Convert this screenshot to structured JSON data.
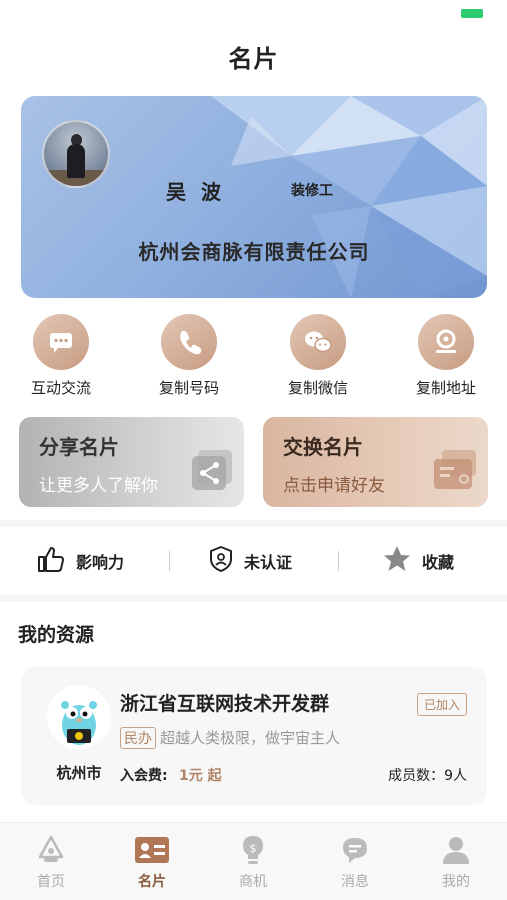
{
  "page": {
    "title": "名片"
  },
  "card": {
    "name": "吴  波",
    "job": "装修工",
    "company": "杭州会商脉有限责任公司"
  },
  "actions": [
    {
      "label": "互动交流",
      "icon": "chat-icon"
    },
    {
      "label": "复制号码",
      "icon": "phone-icon"
    },
    {
      "label": "复制微信",
      "icon": "wechat-icon"
    },
    {
      "label": "复制地址",
      "icon": "location-icon"
    }
  ],
  "promos": {
    "share": {
      "title": "分享名片",
      "subtitle": "让更多人了解你"
    },
    "exchange": {
      "title": "交换名片",
      "subtitle": "点击申请好友"
    }
  },
  "stats": {
    "influence": "影响力",
    "verify": "未认证",
    "favorite": "收藏"
  },
  "resources": {
    "section_title": "我的资源",
    "item": {
      "name": "浙江省互联网技术开发群",
      "joined": "已加入",
      "tag": "民办",
      "desc": "超越人类极限，做宇宙主人",
      "city": "杭州市",
      "fee_label": "入会费:",
      "fee": "1元 起",
      "members": "成员数：9人"
    }
  },
  "tabs": [
    {
      "label": "首页",
      "icon": "home-icon"
    },
    {
      "label": "名片",
      "icon": "card-icon",
      "active": true
    },
    {
      "label": "商机",
      "icon": "bulb-icon"
    },
    {
      "label": "消息",
      "icon": "message-icon"
    },
    {
      "label": "我的",
      "icon": "user-icon"
    }
  ],
  "colors": {
    "accent": "#c79c82",
    "accent_text": "#8a5a3e",
    "card_blue": "#90b0df",
    "battery": "#2ecc71"
  }
}
